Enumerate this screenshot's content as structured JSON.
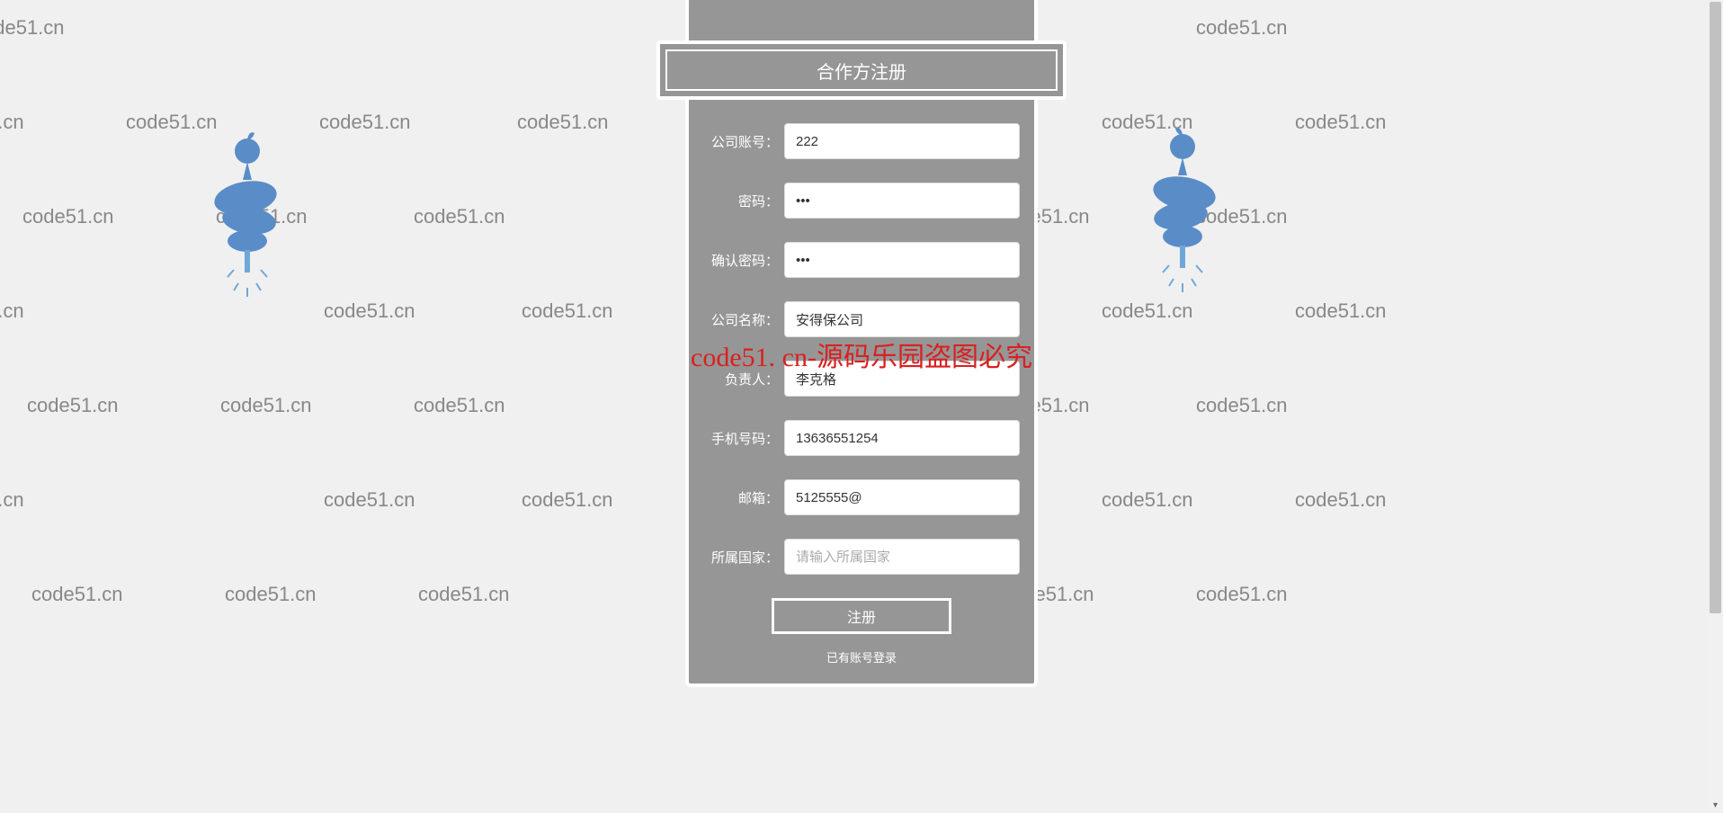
{
  "header": {
    "title": "合作方注册"
  },
  "form": {
    "account": {
      "label": "公司账号：",
      "value": "222"
    },
    "password": {
      "label": "密码：",
      "value": "•••"
    },
    "confirm": {
      "label": "确认密码：",
      "value": "•••"
    },
    "company": {
      "label": "公司名称：",
      "value": "安得保公司"
    },
    "owner": {
      "label": "负责人：",
      "value": "李克格"
    },
    "phone": {
      "label": "手机号码：",
      "value": "13636551254"
    },
    "email": {
      "label": "邮箱：",
      "value": "5125555@"
    },
    "country": {
      "label": "所属国家：",
      "value": "",
      "placeholder": "请输入所属国家"
    }
  },
  "actions": {
    "register": "注册",
    "login_link": "已有账号登录"
  },
  "watermark": {
    "text": "code51.cn",
    "center": "code51. cn-源码乐园盗图必究"
  }
}
